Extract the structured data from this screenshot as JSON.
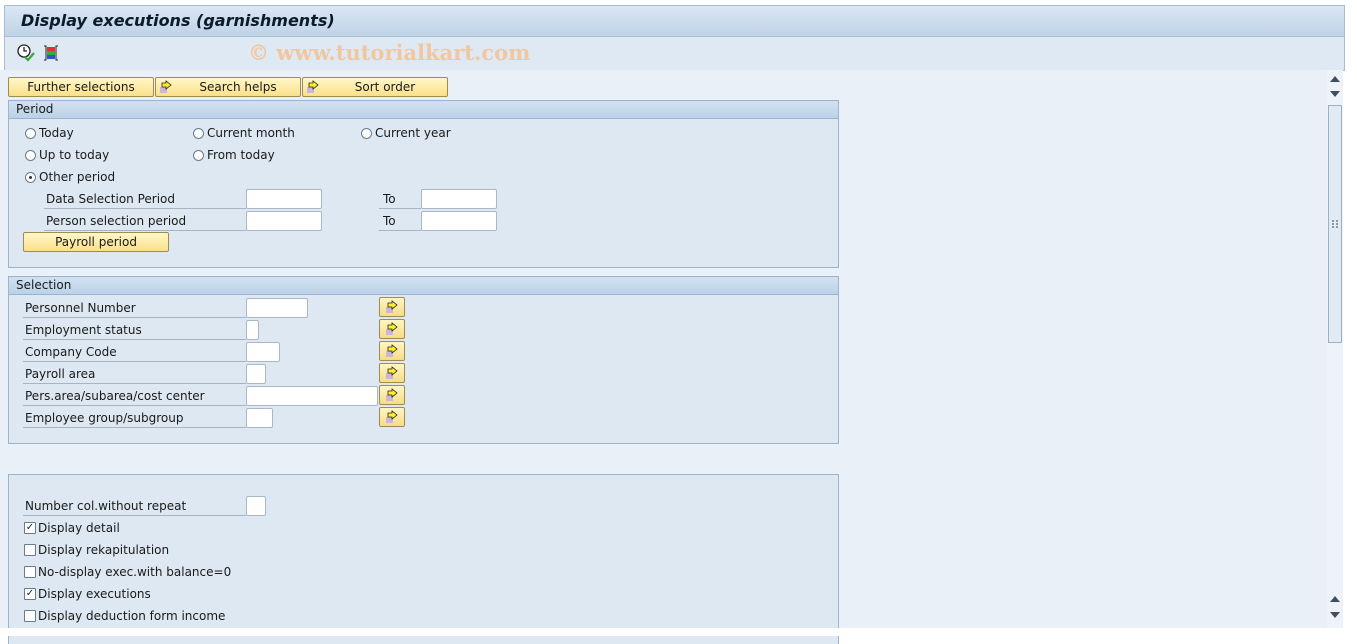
{
  "window": {
    "title": "Display executions (garnishments)",
    "watermark": "© www.tutorialkart.com"
  },
  "toolbar": {
    "icons": [
      "execute-with-clock-icon",
      "multiple-selection-icon"
    ]
  },
  "buttons": {
    "further_selections": "Further selections",
    "search_helps": "Search helps",
    "sort_order": "Sort order"
  },
  "period": {
    "title": "Period",
    "radios": [
      {
        "label": "Today",
        "selected": false
      },
      {
        "label": "Current month",
        "selected": false
      },
      {
        "label": "Current year",
        "selected": false
      },
      {
        "label": "Up to today",
        "selected": false
      },
      {
        "label": "From today",
        "selected": false
      },
      {
        "label": "Other period",
        "selected": true
      }
    ],
    "data_selection_label": "Data Selection Period",
    "data_selection_from": "",
    "data_selection_to_label": "To",
    "data_selection_to": "",
    "person_selection_label": "Person selection period",
    "person_selection_from": "",
    "person_selection_to_label": "To",
    "person_selection_to": "",
    "payroll_period_button": "Payroll period"
  },
  "selection": {
    "title": "Selection",
    "fields": [
      {
        "label": "Personnel Number",
        "value": ""
      },
      {
        "label": "Employment status",
        "value": ""
      },
      {
        "label": "Company Code",
        "value": ""
      },
      {
        "label": "Payroll area",
        "value": ""
      },
      {
        "label": "Pers.area/subarea/cost center",
        "value": ""
      },
      {
        "label": "Employee group/subgroup",
        "value": ""
      }
    ]
  },
  "options": {
    "number_col_label": "Number col.without repeat",
    "number_col_value": "",
    "checkboxes": [
      {
        "label": "Display detail",
        "checked": true
      },
      {
        "label": "Display rekapitulation",
        "checked": false
      },
      {
        "label": "No-display exec.with balance=0",
        "checked": false
      },
      {
        "label": "Display executions",
        "checked": true
      },
      {
        "label": "Display deduction form income",
        "checked": false
      }
    ]
  }
}
